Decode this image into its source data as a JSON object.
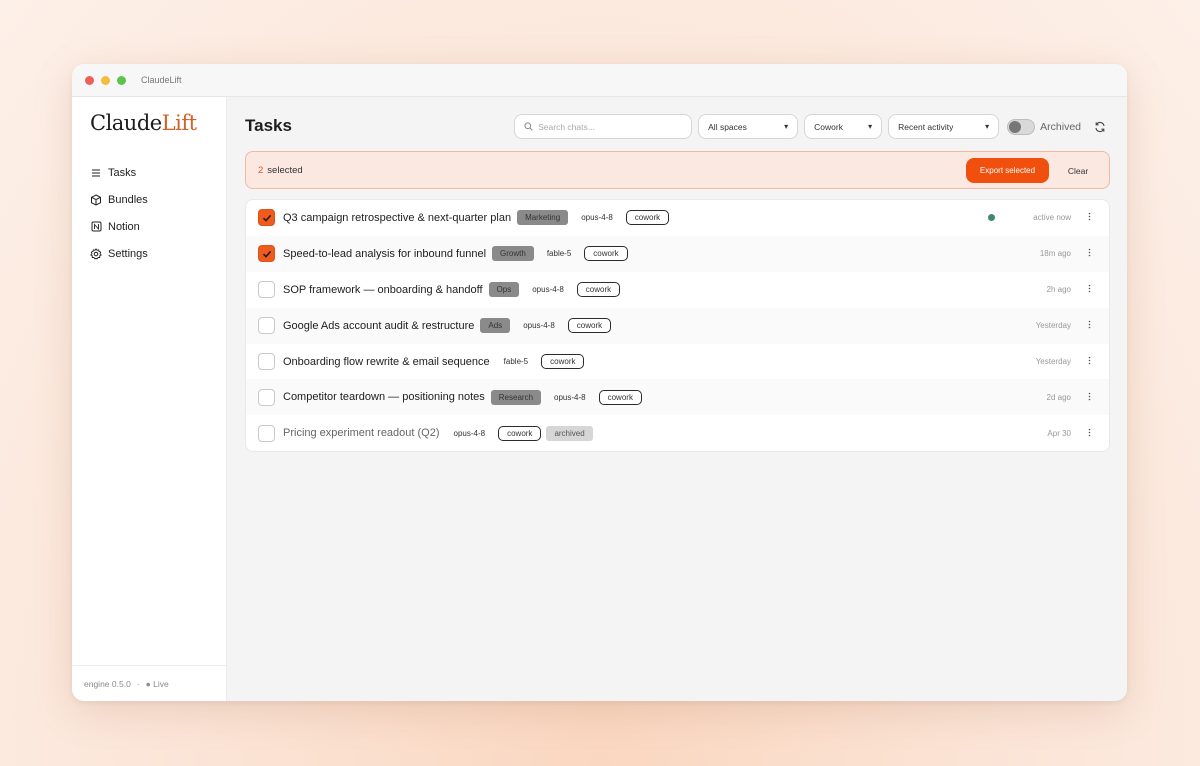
{
  "window": {
    "title": "ClaudeLift"
  },
  "sidebar": {
    "logo_main": "Claude",
    "logo_accent": "Lift",
    "items": [
      {
        "label": "Tasks",
        "icon": "list-icon"
      },
      {
        "label": "Bundles",
        "icon": "box-icon"
      },
      {
        "label": "Notion",
        "icon": "notion-icon"
      },
      {
        "label": "Settings",
        "icon": "gear-icon"
      }
    ],
    "footer": {
      "version": "engine 0.5.0",
      "separator": "·",
      "status": "● Live"
    }
  },
  "header": {
    "title": "Tasks",
    "search_placeholder": "Search chats...",
    "filters": {
      "space": "All spaces",
      "mode": "Cowork",
      "sort": "Recent activity"
    },
    "archived_label": "Archived",
    "archived_on": false
  },
  "selection": {
    "count": "2",
    "label": "selected",
    "export_label": "Export selected",
    "clear_label": "Clear"
  },
  "colors": {
    "accent": "#f04f0e",
    "live_dot": "#3f8a6f"
  },
  "tasks": [
    {
      "title": "Q3 campaign retrospective & next-quarter plan",
      "checked": true,
      "category": "Marketing",
      "model": "opus-4-8",
      "mode": "cowork",
      "time": "active now",
      "active": true
    },
    {
      "title": "Speed-to-lead analysis for inbound funnel",
      "checked": true,
      "category": "Growth",
      "model": "fable-5",
      "mode": "cowork",
      "time": "18m ago"
    },
    {
      "title": "SOP framework — onboarding & handoff",
      "checked": false,
      "category": "Ops",
      "model": "opus-4-8",
      "mode": "cowork",
      "time": "2h ago"
    },
    {
      "title": "Google Ads account audit & restructure",
      "checked": false,
      "category": "Ads",
      "model": "opus-4-8",
      "mode": "cowork",
      "time": "Yesterday"
    },
    {
      "title": "Onboarding flow rewrite & email sequence",
      "checked": false,
      "model": "fable-5",
      "mode": "cowork",
      "time": "Yesterday"
    },
    {
      "title": "Competitor teardown — positioning notes",
      "checked": false,
      "category": "Research",
      "model": "opus-4-8",
      "mode": "cowork",
      "time": "2d ago"
    },
    {
      "title": "Pricing experiment readout (Q2)",
      "checked": false,
      "model": "opus-4-8",
      "mode": "cowork",
      "status_tag": "archived",
      "time": "Apr 30",
      "dim": true
    }
  ]
}
